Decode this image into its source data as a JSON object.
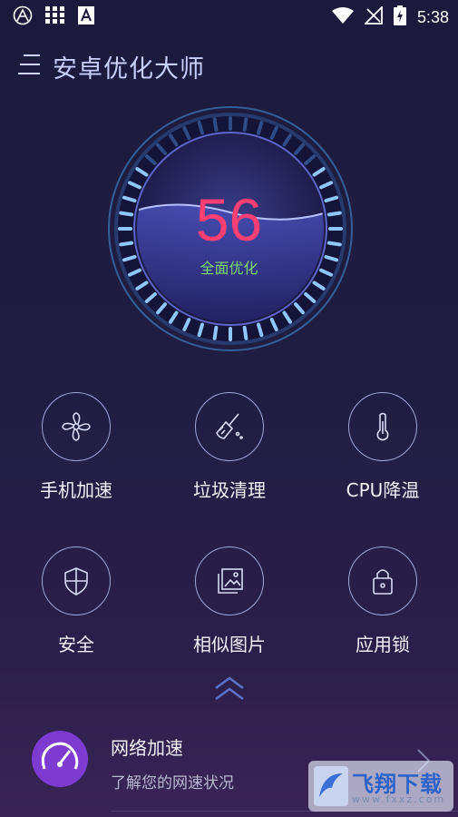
{
  "status_bar": {
    "time": "5:38"
  },
  "header": {
    "title": "安卓优化大师"
  },
  "gauge": {
    "score": "56",
    "label": "全面优化",
    "score_color": "#ff3f73",
    "label_color": "#7dd96a",
    "fill_fraction": 0.56
  },
  "features": [
    {
      "label": "手机加速",
      "icon": "fan-icon"
    },
    {
      "label": "垃圾清理",
      "icon": "broom-icon"
    },
    {
      "label": "CPU降温",
      "icon": "thermometer-icon"
    },
    {
      "label": "安全",
      "icon": "shield-icon"
    },
    {
      "label": "相似图片",
      "icon": "photo-icon"
    },
    {
      "label": "应用锁",
      "icon": "lock-icon"
    }
  ],
  "network": {
    "title": "网络加速",
    "subtitle": "了解您的网速状况",
    "accent": "#7d3bd2"
  },
  "watermark": {
    "text": "飞翔下载",
    "url": "www.fxxz.com"
  }
}
